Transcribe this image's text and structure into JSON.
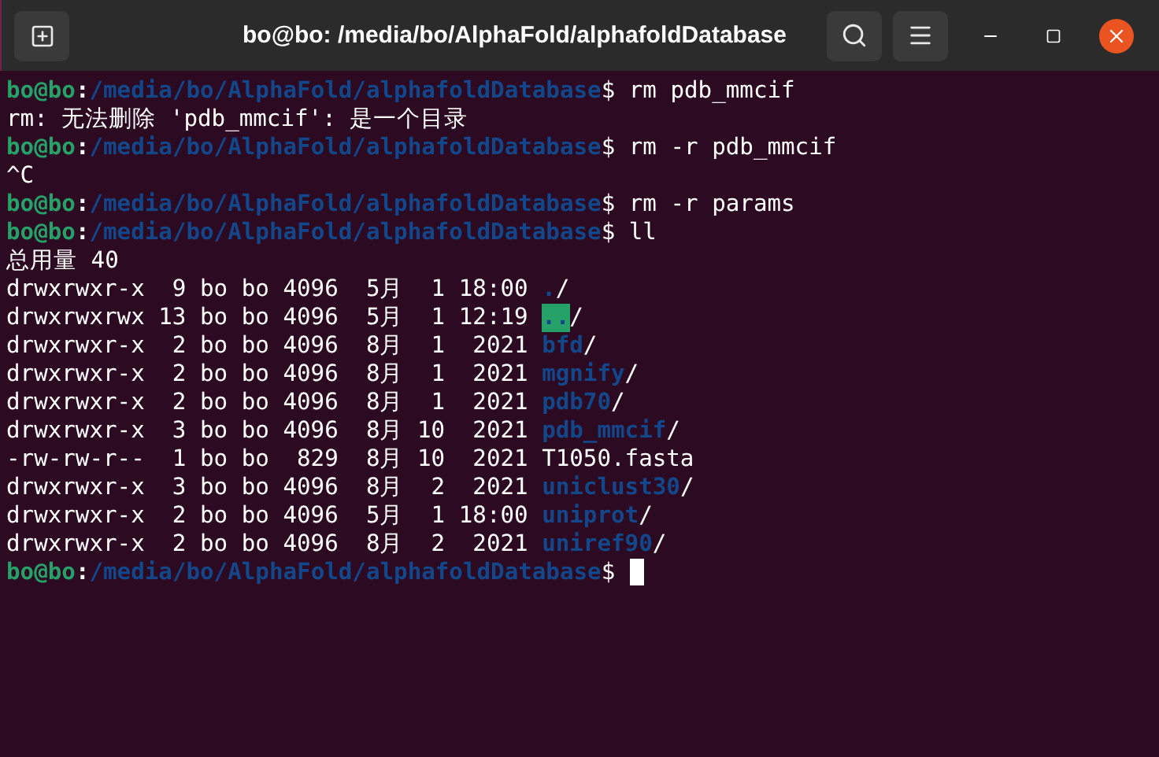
{
  "window": {
    "title": "bo@bo: /media/bo/AlphaFold/alphafoldDatabase"
  },
  "terminal": {
    "lines": [
      {
        "kind": "prompt",
        "user": "bo@bo",
        "separator": ":",
        "path": "/media/bo/AlphaFold/alphafoldDatabase",
        "symbol": "$",
        "command": "rm pdb_mmcif"
      },
      {
        "kind": "output",
        "text": "rm: 无法删除 'pdb_mmcif': 是一个目录"
      },
      {
        "kind": "prompt",
        "user": "bo@bo",
        "separator": ":",
        "path": "/media/bo/AlphaFold/alphafoldDatabase",
        "symbol": "$",
        "command": "rm -r pdb_mmcif"
      },
      {
        "kind": "output",
        "text": "^C"
      },
      {
        "kind": "prompt",
        "user": "bo@bo",
        "separator": ":",
        "path": "/media/bo/AlphaFold/alphafoldDatabase",
        "symbol": "$",
        "command": "rm -r params"
      },
      {
        "kind": "prompt",
        "user": "bo@bo",
        "separator": ":",
        "path": "/media/bo/AlphaFold/alphafoldDatabase",
        "symbol": "$",
        "command": "ll"
      },
      {
        "kind": "output",
        "text": "总用量 40"
      },
      {
        "kind": "entry",
        "meta": "drwxrwxr-x  9 bo bo 4096  5月  1 18:00",
        "name": ".",
        "suffix": "/",
        "is_dir": true,
        "highlighted": false
      },
      {
        "kind": "entry",
        "meta": "drwxrwxrwx 13 bo bo 4096  5月  1 12:19",
        "name": "..",
        "suffix": "/",
        "is_dir": true,
        "highlighted": true
      },
      {
        "kind": "entry",
        "meta": "drwxrwxr-x  2 bo bo 4096  8月  1  2021",
        "name": "bfd",
        "suffix": "/",
        "is_dir": true,
        "highlighted": false
      },
      {
        "kind": "entry",
        "meta": "drwxrwxr-x  2 bo bo 4096  8月  1  2021",
        "name": "mgnify",
        "suffix": "/",
        "is_dir": true,
        "highlighted": false
      },
      {
        "kind": "entry",
        "meta": "drwxrwxr-x  2 bo bo 4096  8月  1  2021",
        "name": "pdb70",
        "suffix": "/",
        "is_dir": true,
        "highlighted": false
      },
      {
        "kind": "entry",
        "meta": "drwxrwxr-x  3 bo bo 4096  8月 10  2021",
        "name": "pdb_mmcif",
        "suffix": "/",
        "is_dir": true,
        "highlighted": false
      },
      {
        "kind": "entry",
        "meta": "-rw-rw-r--  1 bo bo  829  8月 10  2021",
        "name": "T1050.fasta",
        "is_dir": false,
        "highlighted": false
      },
      {
        "kind": "entry",
        "meta": "drwxrwxr-x  3 bo bo 4096  8月  2  2021",
        "name": "uniclust30",
        "suffix": "/",
        "is_dir": true,
        "highlighted": false
      },
      {
        "kind": "entry",
        "meta": "drwxrwxr-x  2 bo bo 4096  5月  1 18:00",
        "name": "uniprot",
        "suffix": "/",
        "is_dir": true,
        "highlighted": false
      },
      {
        "kind": "entry",
        "meta": "drwxrwxr-x  2 bo bo 4096  8月  2  2021",
        "name": "uniref90",
        "suffix": "/",
        "is_dir": true,
        "highlighted": false
      },
      {
        "kind": "prompt",
        "user": "bo@bo",
        "separator": ":",
        "path": "/media/bo/AlphaFold/alphafoldDatabase",
        "symbol": "$",
        "cursor": true
      }
    ]
  }
}
